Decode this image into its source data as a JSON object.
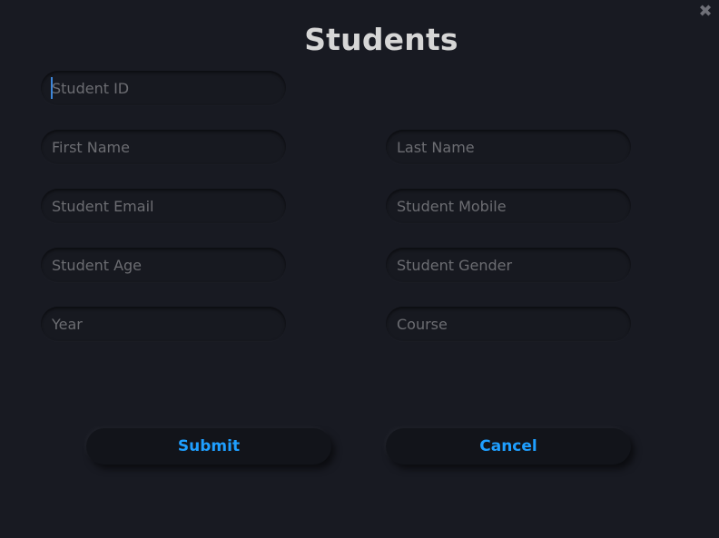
{
  "window": {
    "title": "Students",
    "close_glyph": "✖"
  },
  "form": {
    "student_id": {
      "value": "",
      "placeholder": "Student ID"
    },
    "first_name": {
      "value": "",
      "placeholder": "First Name"
    },
    "last_name": {
      "value": "",
      "placeholder": "Last Name"
    },
    "student_email": {
      "value": "",
      "placeholder": "Student Email"
    },
    "student_mobile": {
      "value": "",
      "placeholder": "Student Mobile"
    },
    "student_age": {
      "value": "",
      "placeholder": "Student Age"
    },
    "student_gender": {
      "value": "",
      "placeholder": "Student Gender"
    },
    "year": {
      "value": "",
      "placeholder": "Year"
    },
    "course": {
      "value": "",
      "placeholder": "Course"
    }
  },
  "actions": {
    "submit_label": "Submit",
    "cancel_label": "Cancel"
  },
  "colors": {
    "background": "#181a22",
    "accent": "#1f9fff",
    "title": "#d6d6d6",
    "placeholder": "#6c6d72"
  },
  "icons": {
    "close": "close-icon"
  }
}
